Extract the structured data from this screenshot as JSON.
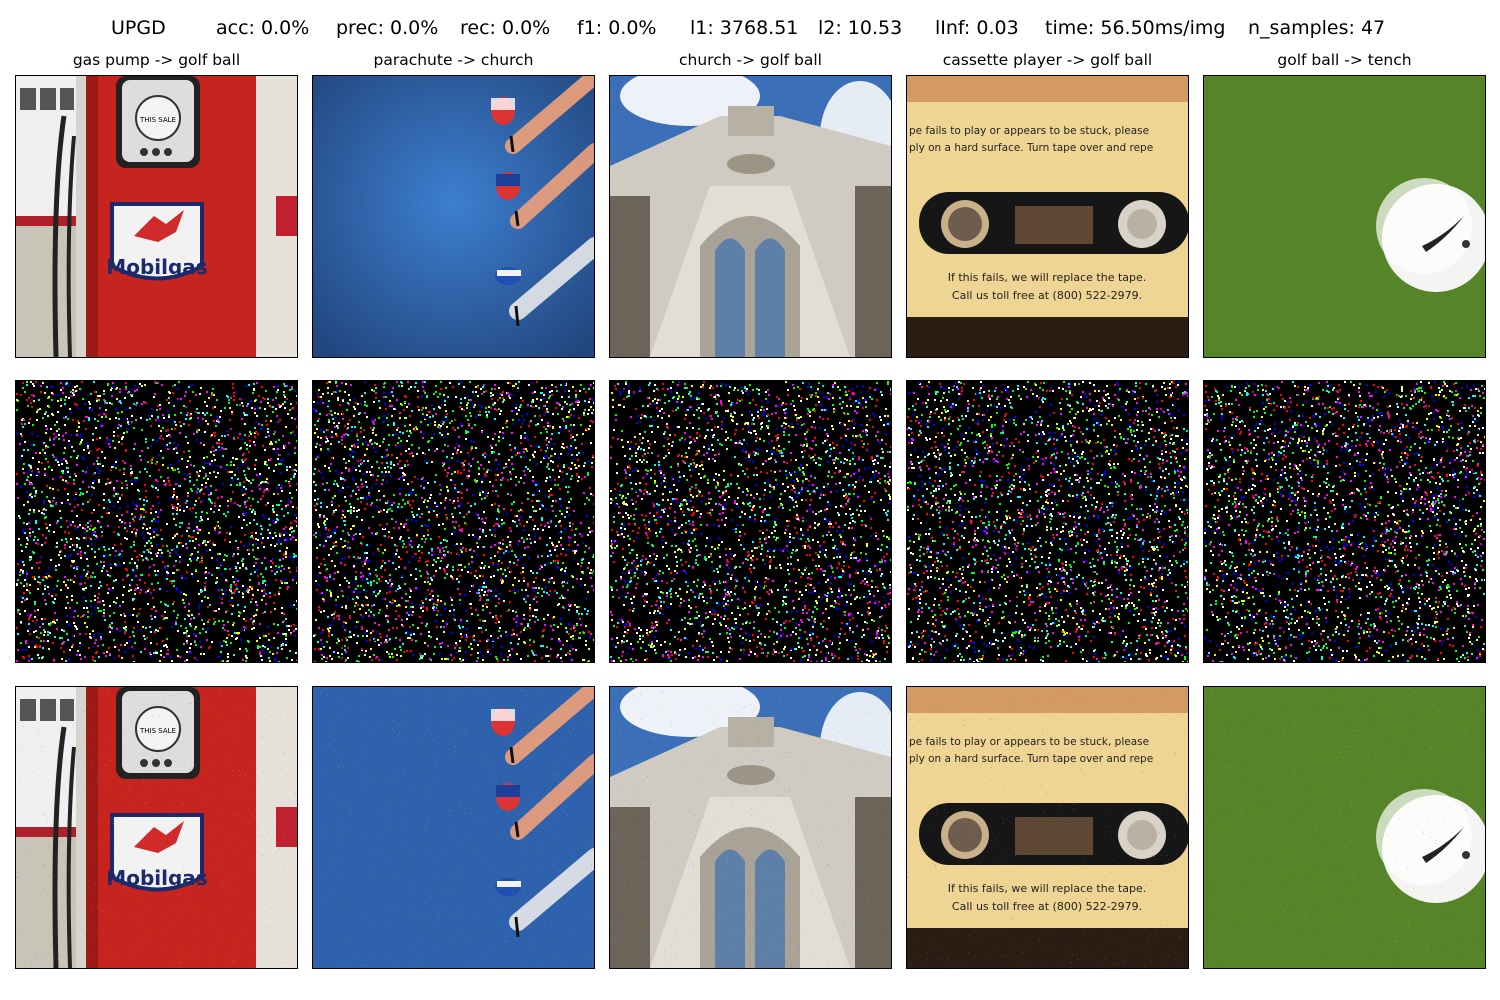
{
  "header": {
    "metrics": [
      "UPGD",
      "acc: 0.0%",
      "prec: 0.0%",
      "rec: 0.0%",
      "f1: 0.0%",
      "l1: 3768.51",
      "l2: 10.53",
      "lInf: 0.03",
      "time: 56.50ms/img",
      "n_samples: 47"
    ]
  },
  "columns": [
    {
      "title": "gas pump -> golf ball",
      "image": "gas-pump-photo"
    },
    {
      "title": "parachute -> church",
      "image": "parachute-photo"
    },
    {
      "title": "church -> golf ball",
      "image": "church-photo"
    },
    {
      "title": "cassette player -> golf ball",
      "image": "cassette-photo"
    },
    {
      "title": "golf ball -> tench",
      "image": "golf-ball-photo"
    }
  ],
  "rows": [
    "original",
    "perturbation",
    "adversarial"
  ],
  "gas_pump": {
    "sign": "Mobilgas",
    "meter": "THIS SALE"
  },
  "cassette": {
    "line1": "pe fails to play or appears to be stuck, please",
    "line2": "ply on a hard surface. Turn tape over and repe",
    "line3": "If this fails, we will replace the tape.",
    "line4": "Call us toll free at (800) 522-2979."
  },
  "colors": {
    "noise": [
      "#ff0000",
      "#00ff00",
      "#0000ff",
      "#ff00ff",
      "#ffff00",
      "#00ffff",
      "#ffffff"
    ]
  }
}
